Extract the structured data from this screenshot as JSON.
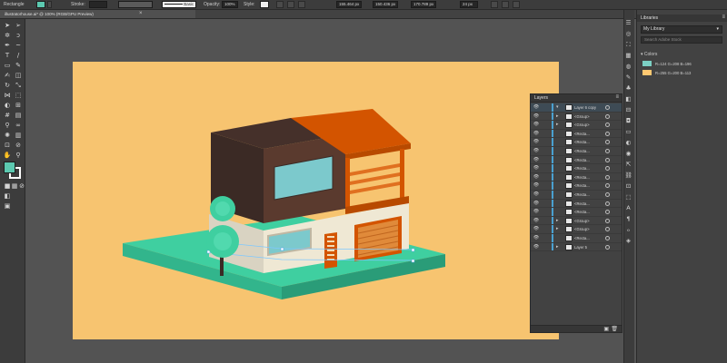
{
  "control_bar": {
    "selection": "Rectangle",
    "fill_color": "#5cc9b0",
    "stroke_label": "Stroke:",
    "stroke_value": "",
    "brush_label": "Basic",
    "opacity_label": "Opacity:",
    "opacity_value": "100%",
    "style_label": "Style:",
    "x_value": "155.464 px",
    "y_value": "150.436 px",
    "w_value": "170.789 px",
    "h_value": "24 px"
  },
  "document": {
    "tab_label": "illustratorhouse.ai* @ 100% (RGB/GPU Preview)",
    "close_symbol": "×"
  },
  "toolbox": {
    "fill_color": "#5cc9b0",
    "stroke_color": "#ffffff"
  },
  "artboard": {
    "background": "#f7c470"
  },
  "layers": {
    "title": "Layers",
    "rows": [
      {
        "name": "Layer 6 copy",
        "arrow": "▾",
        "selected": true
      },
      {
        "name": "<Group>",
        "arrow": "▸"
      },
      {
        "name": "<Group>",
        "arrow": "▸"
      },
      {
        "name": "<Recta...",
        "arrow": ""
      },
      {
        "name": "<Recta...",
        "arrow": ""
      },
      {
        "name": "<Recta...",
        "arrow": ""
      },
      {
        "name": "<Recta...",
        "arrow": ""
      },
      {
        "name": "<Recta...",
        "arrow": ""
      },
      {
        "name": "<Recta...",
        "arrow": ""
      },
      {
        "name": "<Recta...",
        "arrow": ""
      },
      {
        "name": "<Recta...",
        "arrow": ""
      },
      {
        "name": "<Recta...",
        "arrow": ""
      },
      {
        "name": "<Recta...",
        "arrow": ""
      },
      {
        "name": "<Group>",
        "arrow": "▸"
      },
      {
        "name": "<Group>",
        "arrow": "▸"
      },
      {
        "name": "<Recta...",
        "arrow": ""
      },
      {
        "name": "Layer 5",
        "arrow": "▸"
      }
    ]
  },
  "libraries": {
    "title": "Libraries",
    "selected_library": "My Library",
    "search_placeholder": "Search Adobe Stock",
    "colors_title": "Colors",
    "colors": [
      {
        "label": "R=124 G=208 B=196",
        "hex": "#7cd0c4"
      },
      {
        "label": "R=255 G=200 B=113",
        "hex": "#ffc871"
      }
    ]
  }
}
